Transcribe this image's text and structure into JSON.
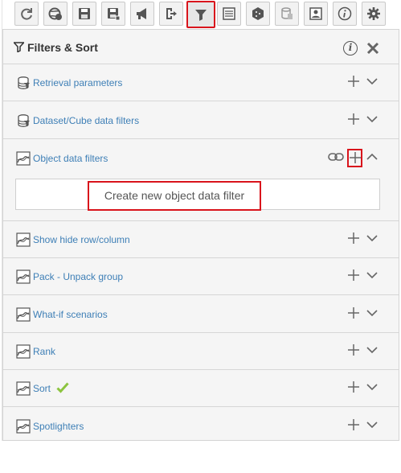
{
  "toolbar": {
    "buttons": [
      {
        "name": "refresh-icon"
      },
      {
        "name": "world-refresh-icon"
      },
      {
        "name": "save-icon"
      },
      {
        "name": "save-as-icon"
      },
      {
        "name": "megaphone-icon"
      },
      {
        "name": "export-icon"
      },
      {
        "name": "filter-icon",
        "active": true
      },
      {
        "name": "list-report-icon"
      },
      {
        "name": "cube-icon"
      },
      {
        "name": "database-icon"
      },
      {
        "name": "picture-icon"
      },
      {
        "name": "info-icon"
      },
      {
        "name": "gear-icon"
      }
    ]
  },
  "panel": {
    "title": "Filters & Sort",
    "rows": [
      {
        "label": "Retrieval parameters",
        "icon": "database-filter-icon"
      },
      {
        "label": "Dataset/Cube data filters",
        "icon": "database-filter-icon"
      },
      {
        "label": "Object data filters",
        "icon": "chart-filter-icon",
        "expanded": true,
        "create_label": "Create new object data filter"
      },
      {
        "label": "Show hide row/column",
        "icon": "chart-filter-icon"
      },
      {
        "label": "Pack - Unpack group",
        "icon": "chart-filter-icon"
      },
      {
        "label": "What-if scenarios",
        "icon": "chart-filter-icon"
      },
      {
        "label": "Rank",
        "icon": "chart-filter-icon"
      },
      {
        "label": "Sort",
        "icon": "chart-filter-icon",
        "checked": true
      },
      {
        "label": "Spotlighters",
        "icon": "chart-filter-icon"
      }
    ]
  },
  "colors": {
    "label_blue": "#3e7fb6",
    "highlight_red": "#d9141c",
    "check_green": "#8cc43f"
  }
}
